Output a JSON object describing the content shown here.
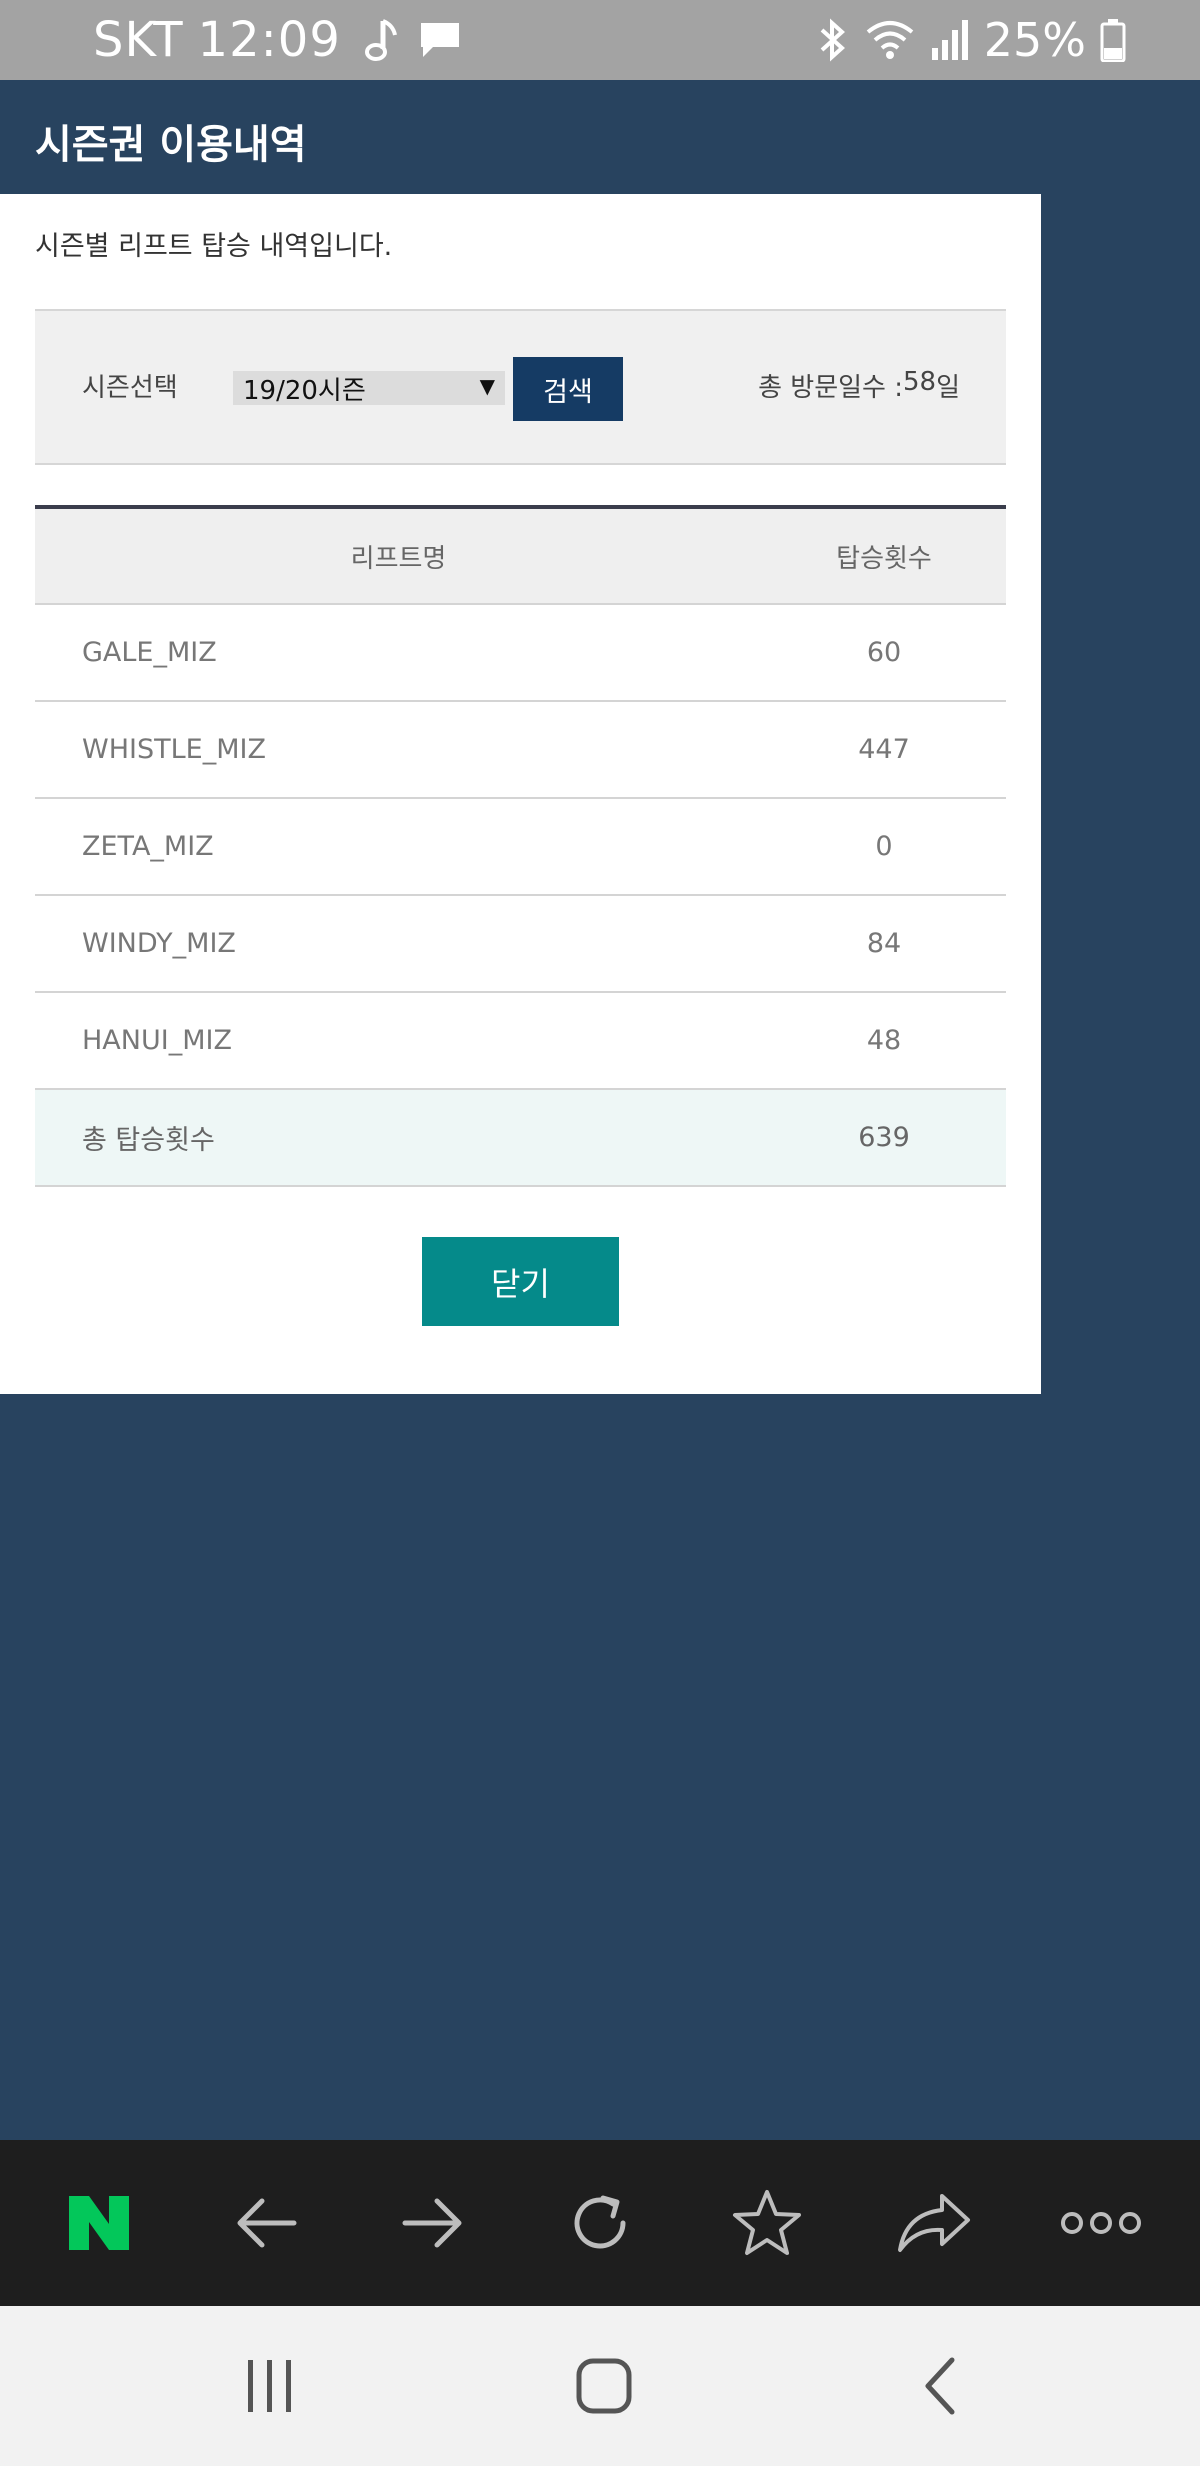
{
  "status_bar": {
    "carrier": "SKT",
    "time": "12:09",
    "battery": "25%"
  },
  "page": {
    "title": "시즌권 이용내역",
    "intro": "시즌별 리프트 탑승 내역입니다."
  },
  "search": {
    "season_label": "시즌선택",
    "season_selected": "19/20시즌",
    "search_button": "검색",
    "visit_label": "총 방문일수 :",
    "visit_value": "58",
    "visit_unit": "일"
  },
  "table": {
    "headers": [
      "리프트명",
      "탑승횟수"
    ],
    "rows": [
      {
        "name": "GALE_MIZ",
        "count": "60"
      },
      {
        "name": "WHISTLE_MIZ",
        "count": "447"
      },
      {
        "name": "ZETA_MIZ",
        "count": "0"
      },
      {
        "name": "WINDY_MIZ",
        "count": "84"
      },
      {
        "name": "HANUI_MIZ",
        "count": "48"
      }
    ],
    "total": {
      "label": "총 탑승횟수",
      "count": "639"
    }
  },
  "close_button": "닫기",
  "browser_bar": {
    "logo": "N",
    "icons": [
      "naver-logo-icon",
      "back-arrow-icon",
      "forward-arrow-icon",
      "reload-icon",
      "star-icon",
      "share-icon",
      "more-icon"
    ]
  },
  "nav_bar": {
    "icons": [
      "recent-apps-icon",
      "home-icon",
      "back-icon"
    ]
  },
  "colors": {
    "background": "#28435f",
    "search_button": "#153b64",
    "close_button": "#058a8a",
    "naver_green": "#03c75a"
  }
}
